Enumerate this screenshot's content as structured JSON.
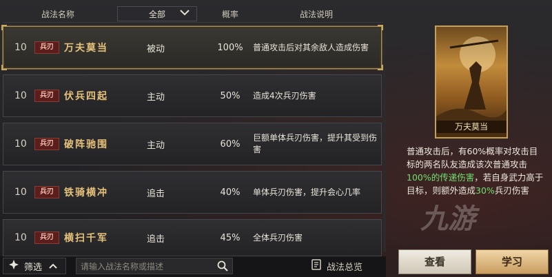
{
  "header": {
    "col_name": "战法名称",
    "col_filter": "全部",
    "col_rate": "概率",
    "col_desc": "战法说明"
  },
  "rows": [
    {
      "level": "10",
      "tag": "兵刃",
      "name": "万夫莫当",
      "type": "被动",
      "rate": "100%",
      "desc": "普通攻击后对其余敌人造成伤害"
    },
    {
      "level": "10",
      "tag": "兵刃",
      "name": "伏兵四起",
      "type": "主动",
      "rate": "50%",
      "desc": "造成4次兵刃伤害"
    },
    {
      "level": "10",
      "tag": "兵刃",
      "name": "破阵驰围",
      "type": "主动",
      "rate": "60%",
      "desc": "巨额单体兵刃伤害，提升其受到伤害"
    },
    {
      "level": "10",
      "tag": "兵刃",
      "name": "铁骑横冲",
      "type": "追击",
      "rate": "40%",
      "desc": "单体兵刃伤害，提升会心几率"
    },
    {
      "level": "10",
      "tag": "兵刃",
      "name": "横扫千军",
      "type": "追击",
      "rate": "45%",
      "desc": "全体兵刃伤害"
    }
  ],
  "bottom": {
    "filter_label": "筛选",
    "search_placeholder": "请输入战法名称或描述",
    "overview_label": "战法总览"
  },
  "detail": {
    "card_title": "万夫莫当",
    "p1": "普通攻击后，有60%概率对攻击目标的两名队友造成该次普通攻击",
    "p1_hl": "100%的传递伤害",
    "p2": "，若自身武力高于目标，则额外造成",
    "p2_hl": "30%",
    "p3": "兵刃伤害"
  },
  "buttons": {
    "view": "查看",
    "learn": "学习"
  },
  "watermark": "九游"
}
